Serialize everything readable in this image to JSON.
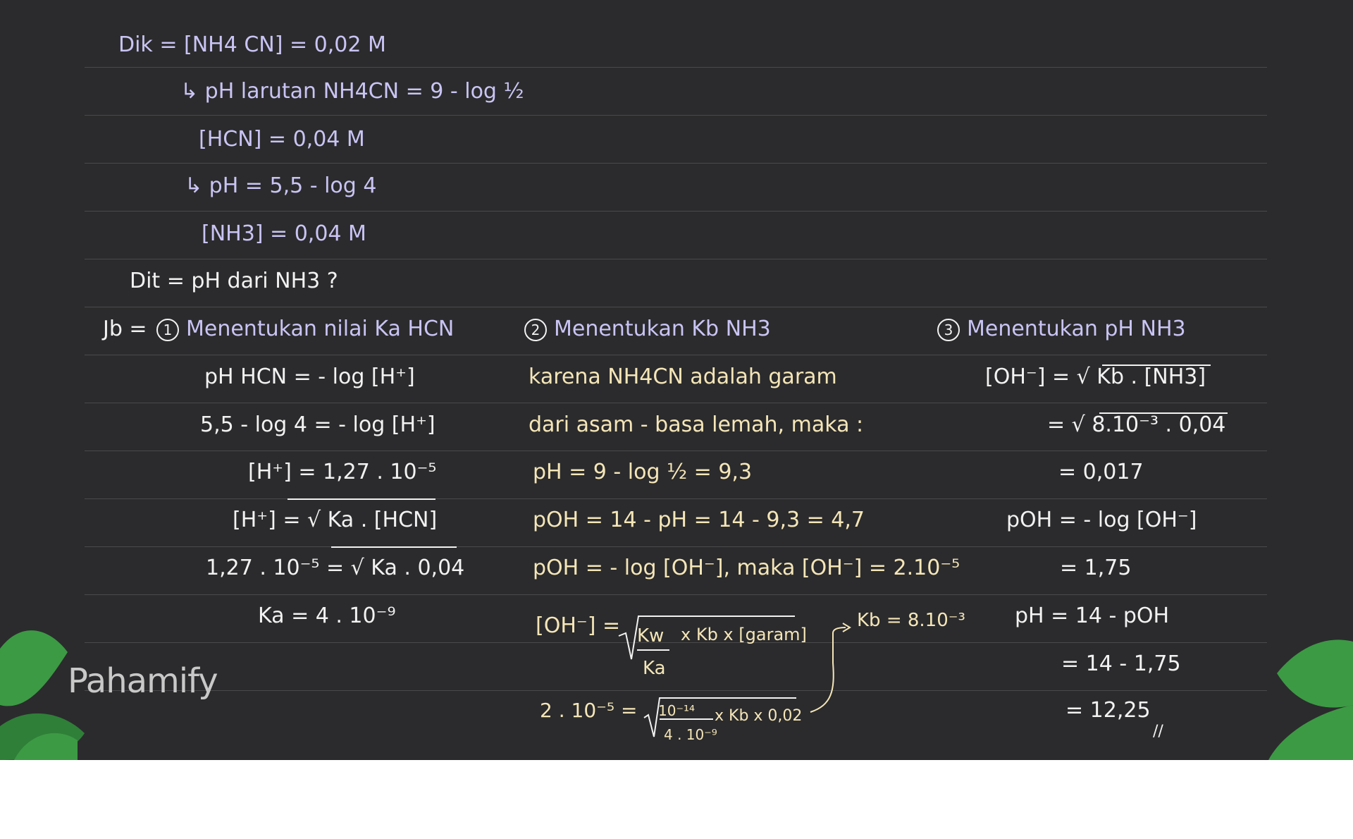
{
  "lines": {
    "l1": "Dik = [NH4 CN] = 0,02 M",
    "l2": "↳ pH larutan NH4CN = 9 - log ½",
    "l3": "[HCN] = 0,04 M",
    "l4": "↳ pH = 5,5 - log 4",
    "l5": "[NH3] = 0,04 M",
    "l6": "Dit = pH dari NH3 ?",
    "jb": "Jb ="
  },
  "col1": {
    "num": "1",
    "title": "Menentukan nilai Ka HCN",
    "r1": "pH HCN = - log [H⁺]",
    "r2": "5,5 - log 4 = - log [H⁺]",
    "r3": "[H⁺] = 1,27 . 10⁻⁵",
    "r4": "[H⁺] = √ Ka . [HCN]",
    "r5": "1,27 . 10⁻⁵ = √ Ka . 0,04",
    "r6": "Ka = 4 . 10⁻⁹"
  },
  "col2": {
    "num": "2",
    "title": "Menentukan Kb NH3",
    "r1": "karena NH4CN adalah garam",
    "r2": "dari asam - basa lemah, maka :",
    "r3": "pH = 9 - log ½ = 9,3",
    "r4": "pOH = 14 - pH = 14 - 9,3 = 4,7",
    "r5": "pOH = - log [OH⁻], maka [OH⁻] = 2.10⁻⁵",
    "r6a": "[OH⁻] =",
    "r6b": "Kw",
    "r6c": "x Kb x [garam]",
    "r6d": "Ka",
    "r6e": "Kb = 8.10⁻³",
    "r7a": "2 . 10⁻⁵ =",
    "r7b": "10⁻¹⁴",
    "r7c": "x Kb x 0,02",
    "r7d": "4 . 10⁻⁹"
  },
  "col3": {
    "num": "3",
    "title": "Menentukan pH NH3",
    "r1": "[OH⁻] = √ Kb . [NH3]",
    "r2": "= √ 8.10⁻³ . 0,04",
    "r3": "= 0,017",
    "r4": "pOH = - log [OH⁻]",
    "r5": "= 1,75",
    "r6": "pH = 14 - pOH",
    "r7": "= 14 - 1,75",
    "r8": "= 12,25",
    "r9": "//"
  },
  "logo": {
    "text": "Pahamify"
  },
  "colors": {
    "board": "#2b2b2d",
    "text": "#c9c4f4",
    "handwriting": "#f5e6b8",
    "leaf": "#3c9a44",
    "ruled_line": "#4a4a4d"
  }
}
